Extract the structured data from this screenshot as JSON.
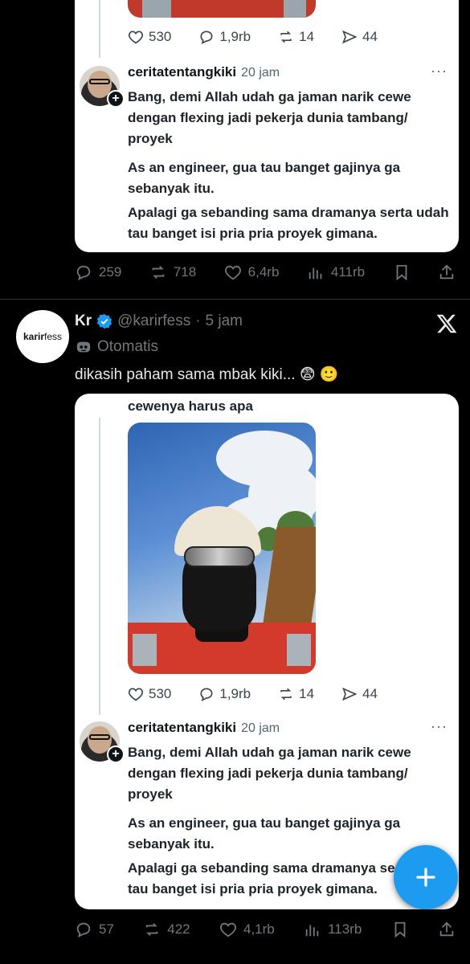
{
  "quoted_card": {
    "metrics": {
      "likes": "530",
      "replies": "1,9rb",
      "reposts": "14",
      "shares": "44"
    },
    "author": "ceritatentangkiki",
    "time": "20 jam",
    "more": "···",
    "paragraphs": [
      "Bang, demi Allah udah ga jaman narik cewe dengan flexing jadi pekerja dunia tambang/ proyek",
      "As an engineer, gua tau banget gajinya ga sebanyak itu.",
      "Apalagi ga sebanding sama dramanya serta udah tau banget isi pria pria proyek gimana."
    ],
    "caption": "cewenya harus apa"
  },
  "previous_tweet_actions": {
    "replies": "259",
    "reposts": "718",
    "likes": "6,4rb",
    "views": "411rb"
  },
  "tweet": {
    "avatar_text_bold": "karir",
    "avatar_text": "fess",
    "name": "Kr",
    "handle": "@karirfess",
    "separator": "·",
    "time": "5 jam",
    "automated_label": "Otomatis",
    "text": "dikasih paham sama mbak kiki...",
    "emoji": "😨 🙂"
  },
  "tweet_actions": {
    "replies": "57",
    "reposts": "422",
    "likes": "4,1rb",
    "views": "113rb"
  },
  "colors": {
    "accent": "#1d9bf0",
    "background": "#000000",
    "secondary_text": "#71767b"
  },
  "icons": [
    "reply-icon",
    "repost-icon",
    "like-icon",
    "views-icon",
    "bookmark-icon",
    "share-icon",
    "verified-badge-icon",
    "robot-icon",
    "x-logo-icon",
    "plus-icon"
  ]
}
